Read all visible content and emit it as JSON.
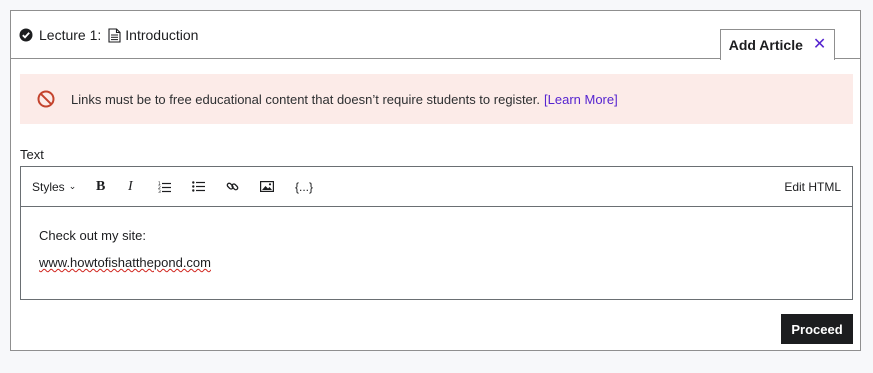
{
  "header": {
    "lecture_prefix": "Lecture 1:",
    "lecture_title": "Introduction",
    "tab_label": "Add Article",
    "tab_close": "✕"
  },
  "alert": {
    "message": "Links must be to free educational content that doesn’t require students to register.",
    "link_label": "[Learn More]",
    "icon": "ban-icon",
    "background": "#fcebe8",
    "icon_color": "#c4432d",
    "link_color": "#5624d0"
  },
  "editor": {
    "label": "Text",
    "toolbar": {
      "styles_label": "Styles",
      "bold_label": "B",
      "italic_label": "I",
      "code_label": "{...}",
      "edit_html_label": "Edit HTML"
    },
    "content": {
      "line1": "Check out my site:",
      "line2": "www.howtofishatthepond.com"
    }
  },
  "actions": {
    "proceed_label": "Proceed"
  }
}
